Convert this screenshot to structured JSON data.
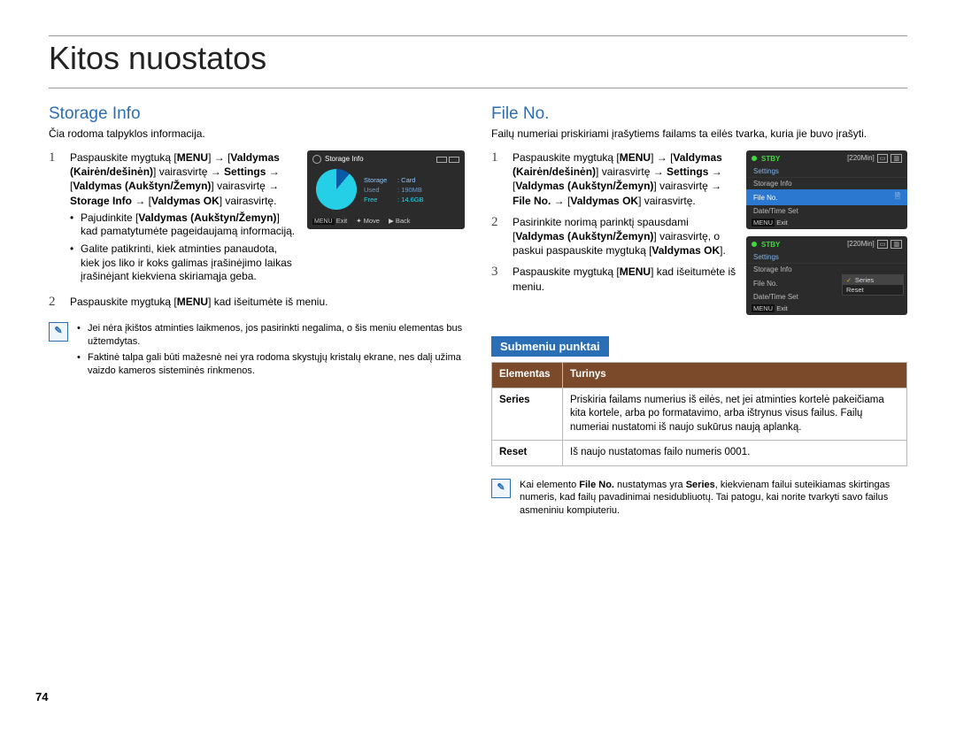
{
  "page": {
    "title": "Kitos nuostatos",
    "number": "74"
  },
  "left": {
    "heading": "Storage Info",
    "lead": "Čia rodoma talpyklos informacija.",
    "step1_html": "Paspauskite mygtuką [<b>MENU</b>] → [<b>Valdymas (Kairėn/dešinėn)</b>] vairasvirtę → <b>Settings</b> → [<b>Valdymas (Aukštyn/Žemyn)</b>] vairasvirtę → <b>Storage Info</b> → [<b>Valdymas OK</b>] vairasvirtę.",
    "sub_a_html": "Pajudinkite [<b>Valdymas (Aukštyn/Žemyn)</b>] kad pamatytumėte pageidaujamą informaciją.",
    "sub_b": "Galite patikrinti, kiek atminties panaudota, kiek jos liko ir koks galimas įrašinėjimo laikas įrašinėjant kiekviena skiriamąja geba.",
    "step2_html": "Paspauskite mygtuką [<b>MENU</b>] kad išeitumėte iš meniu.",
    "note_a": "Jei nėra įkištos atminties laikmenos, jos pasirinkti negalima, o šis meniu elementas bus užtemdytas.",
    "note_b": "Faktinė talpa gali būti mažesnė nei yra rodoma skystųjų kristalų ekrane, nes dalį užima vaizdo kameros sisteminės rinkmenos.",
    "fig": {
      "title": "Storage Info",
      "storage_k": "Storage",
      "storage_v": ": Card",
      "used_k": "Used",
      "used_v": ": 190MB",
      "free_k": "Free",
      "free_v": ": 14.6GB",
      "foot_menu": "MENU",
      "foot_exit": "Exit",
      "foot_move": "Move",
      "foot_back": "Back"
    }
  },
  "right": {
    "heading": "File No.",
    "lead": "Failų numeriai priskiriami įrašytiems failams ta eilės tvarka, kuria jie buvo įrašyti.",
    "step1_html": "Paspauskite mygtuką [<b>MENU</b>] → [<b>Valdymas (Kairėn/dešinėn)</b>] vairasvirtę → <b>Settings</b> → [<b>Valdymas (Aukštyn/Žemyn)</b>] vairasvirtę → <b>File No.</b> → [<b>Valdymas OK</b>] vairasvirtę.",
    "step2_html": "Pasirinkite norimą parinktį spausdami [<b>Valdymas (Aukštyn/Žemyn)</b>] vairasvirtę, o paskui paspauskite mygtuką [<b>Valdymas OK</b>].",
    "step3_html": "Paspauskite mygtuką [<b>MENU</b>] kad išeitumėte iš meniu.",
    "subhead": "Submeniu punktai",
    "table": {
      "col_el": "Elementas",
      "col_co": "Turinys",
      "r1_name": "Series",
      "r1_desc": "Priskiria failams numerius iš eilės, net jei atminties kortelė pakeičiama kita kortele, arba po formatavimo, arba ištrynus visus failus. Failų numeriai nustatomi iš naujo sukūrus naują aplanką.",
      "r2_name": "Reset",
      "r2_desc": "Iš naujo nustatomas failo numeris 0001."
    },
    "note_html": "Kai elemento <b>File No.</b> nustatymas yra <b>Series</b>, kiekvienam failui suteikiamas skirtingas numeris, kad failų pavadinimai nesidubliuotų. Tai patogu, kai norite tvarkyti savo failus asmeniniu kompiuteriu.",
    "fig1": {
      "stby": "STBY",
      "time": "[220Min]",
      "menu0": "Settings",
      "menu1": "Storage Info",
      "menu2": "File No.",
      "menu3": "Date/Time Set",
      "foot_menu": "MENU",
      "foot_exit": "Exit"
    },
    "fig2": {
      "stby": "STBY",
      "time": "[220Min]",
      "menu0": "Settings",
      "menu1": "Storage Info",
      "menu2": "File No.",
      "menu3": "Date/Time Set",
      "pop_a": "Series",
      "pop_b": "Reset",
      "foot_menu": "MENU",
      "foot_exit": "Exit"
    }
  }
}
